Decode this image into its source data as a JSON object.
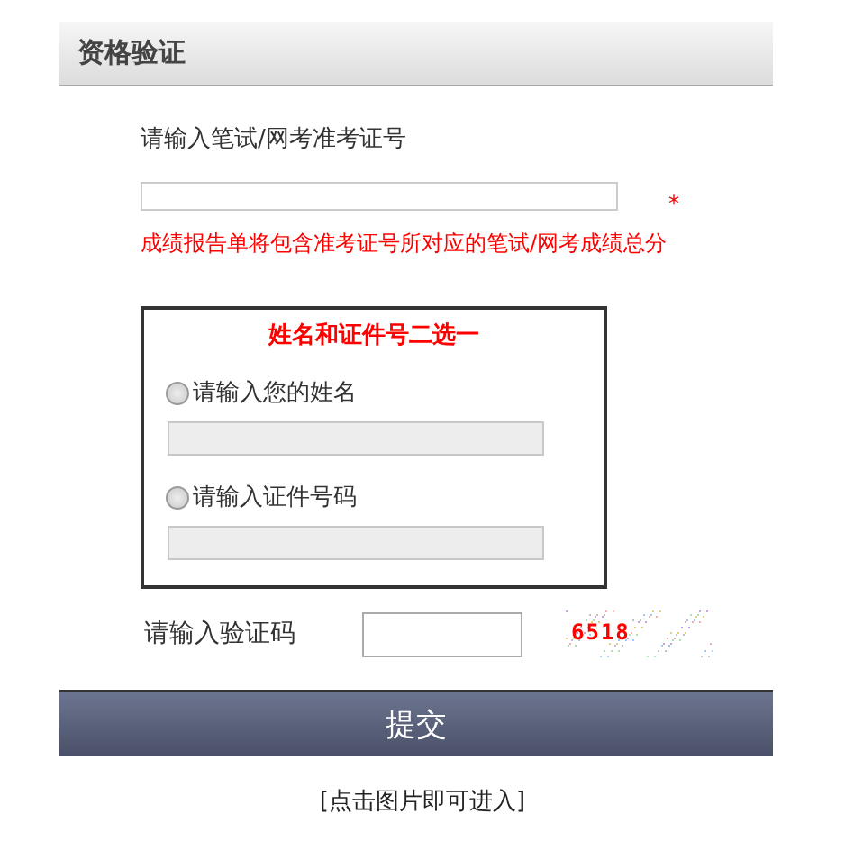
{
  "header": {
    "title": "资格验证"
  },
  "exam_number": {
    "label": "请输入笔试/网考准考证号",
    "required_mark": "*",
    "note": "成绩报告单将包含准考证号所对应的笔试/网考成绩总分"
  },
  "identity_box": {
    "title": "姓名和证件号二选一",
    "options": [
      {
        "label": "请输入您的姓名",
        "selected": false
      },
      {
        "label": "请输入证件号码",
        "selected": false
      }
    ]
  },
  "captcha": {
    "label": "请输入验证码",
    "code": "6518"
  },
  "submit_button": "提交",
  "footer_link": "[点击图片即可进入]"
}
